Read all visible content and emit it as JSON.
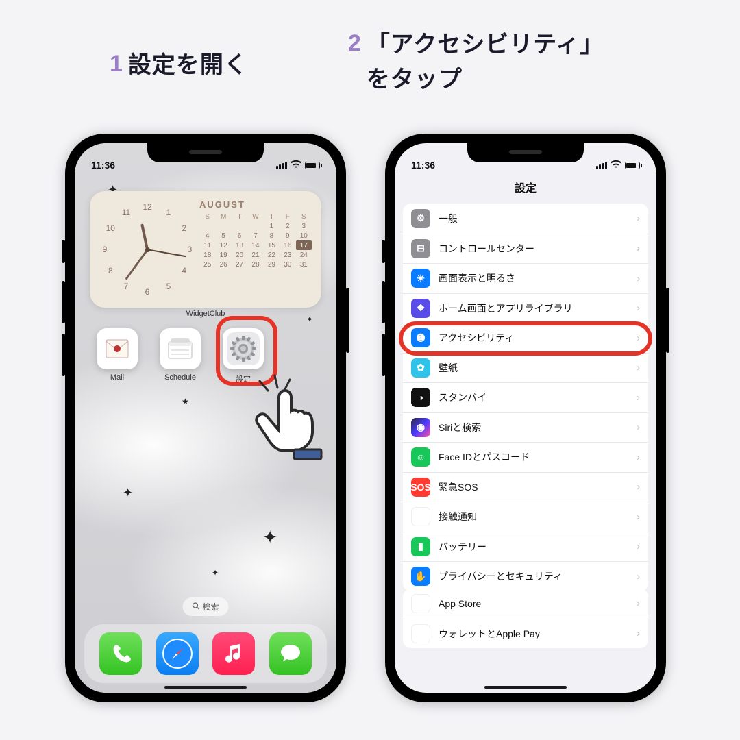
{
  "headings": {
    "step1_num": "1",
    "step1_text": "設定を開く",
    "step2_num": "2",
    "step2_text": "「アクセシビリティ」\nをタップ"
  },
  "status": {
    "time": "11:36"
  },
  "left": {
    "widget_label": "WidgetClub",
    "calendar": {
      "month": "AUGUST",
      "dow": [
        "S",
        "M",
        "T",
        "W",
        "T",
        "F",
        "S"
      ],
      "weeks": [
        [
          "",
          "",
          "1",
          "2",
          "3"
        ],
        [
          "4",
          "5",
          "6",
          "7",
          "8",
          "9",
          "10"
        ],
        [
          "11",
          "12",
          "13",
          "14",
          "15",
          "16",
          "17"
        ],
        [
          "18",
          "19",
          "20",
          "21",
          "22",
          "23",
          "24"
        ],
        [
          "25",
          "26",
          "27",
          "28",
          "29",
          "30",
          "31"
        ]
      ],
      "today": "17"
    },
    "clock_numerals": [
      "12",
      "1",
      "2",
      "3",
      "4",
      "5",
      "6",
      "7",
      "8",
      "9",
      "10",
      "11"
    ],
    "apps": [
      {
        "name": "mail",
        "label": "Mail"
      },
      {
        "name": "schedule",
        "label": "Schedule"
      },
      {
        "name": "settings",
        "label": "設定"
      }
    ],
    "search": "検索",
    "dock": [
      "phone",
      "safari",
      "music",
      "messages"
    ]
  },
  "right": {
    "title": "設定",
    "group1": [
      {
        "id": "general",
        "label": "一般",
        "icon": "⚙"
      },
      {
        "id": "cc",
        "label": "コントロールセンター",
        "icon": "⊟"
      },
      {
        "id": "display",
        "label": "画面表示と明るさ",
        "icon": "☀"
      },
      {
        "id": "home",
        "label": "ホーム画面とアプリライブラリ",
        "icon": "❖"
      },
      {
        "id": "access",
        "label": "アクセシビリティ",
        "icon": "➊"
      },
      {
        "id": "wallpaper",
        "label": "壁紙",
        "icon": "✿"
      },
      {
        "id": "standby",
        "label": "スタンバイ",
        "icon": "◑"
      },
      {
        "id": "siri",
        "label": "Siriと検索",
        "icon": "◉"
      },
      {
        "id": "faceid",
        "label": "Face IDとパスコード",
        "icon": "☺"
      },
      {
        "id": "sos",
        "label": "緊急SOS",
        "icon": "SOS"
      },
      {
        "id": "exposure",
        "label": "接触通知",
        "icon": "✺"
      },
      {
        "id": "battery",
        "label": "バッテリー",
        "icon": "▮"
      },
      {
        "id": "privacy",
        "label": "プライバシーとセキュリティ",
        "icon": "✋"
      }
    ],
    "group2": [
      {
        "id": "appstore",
        "label": "App Store",
        "icon": "A"
      },
      {
        "id": "wallet",
        "label": "ウォレットとApple Pay",
        "icon": "▭"
      }
    ]
  }
}
